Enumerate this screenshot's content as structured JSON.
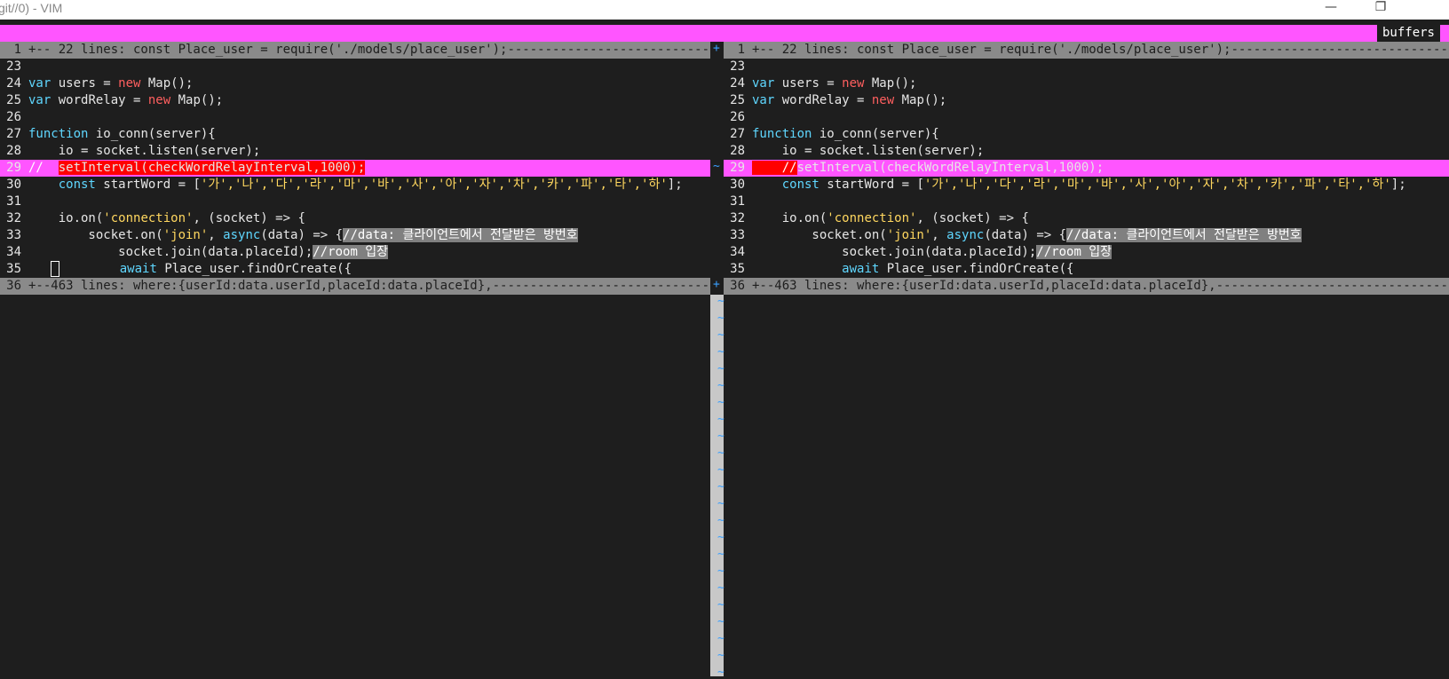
{
  "window": {
    "title": "git//0) - VIM",
    "minimize": "—",
    "restore": "❐"
  },
  "tabline": {
    "buffers": "buffers"
  },
  "left": {
    "fold_top": "+-- 22 lines: const Place_user = require('./models/place_user');-----------------------------------",
    "fold_bottom": "+--463 lines: where:{userId:data.userId,placeId:data.placeId},-----------------------------------------",
    "lines": [
      {
        "n": "1"
      },
      {
        "n": "23"
      },
      {
        "n": "24"
      },
      {
        "n": "25"
      },
      {
        "n": "26"
      },
      {
        "n": "27"
      },
      {
        "n": "28"
      },
      {
        "n": "29"
      },
      {
        "n": "30"
      },
      {
        "n": "31"
      },
      {
        "n": "32"
      },
      {
        "n": "33"
      },
      {
        "n": "34"
      },
      {
        "n": "35"
      },
      {
        "n": "36"
      }
    ]
  },
  "right": {
    "fold_top": "+-- 22 lines: const Place_user = require('./models/place_user');-----------------------------------",
    "fold_bottom": "+--463 lines: where:{userId:data.userId,placeId:data.placeId},-----------------------------------------"
  },
  "code": {
    "var": "var",
    "users": " users = ",
    "new": "new",
    "map": " Map();",
    "wordRelay": " wordRelay = ",
    "function": "function",
    "ioconn": " io_conn(server){",
    "listen": "    io = socket.listen(server);",
    "left_29_comment": "//  ",
    "setInterval": "setInterval(checkWordRelayInterval,1000);",
    "right_29_comment": "//",
    "const": "const",
    "startWord": " startWord = [",
    "chars": "'가','나','다','라','마','바','사','아','자','차','카','파','타','하'",
    "close": "];",
    "ioon": "    io.on(",
    "connection": "'connection'",
    "socketArrow": ", (socket) => {",
    "socketon": "        socket.on(",
    "join": "'join'",
    "async": "async",
    "dataArrow": "(data) => {",
    "comment33": "//data: 클라이언트에서 전달받은 방번호",
    "joinPlace": "            socket.join(data.placeId);",
    "comment34": "//room 입장",
    "await": "await",
    "findOrCreate": " Place_user.findOrCreate({"
  },
  "divider": {
    "plus": "+",
    "tilde": "~"
  },
  "colors": {
    "accent": "#ff55ff",
    "keyword": "#5fd7ff",
    "string": "#ffd75f",
    "keyword_red": "#ff5f5f",
    "background": "#1e1e1e"
  }
}
